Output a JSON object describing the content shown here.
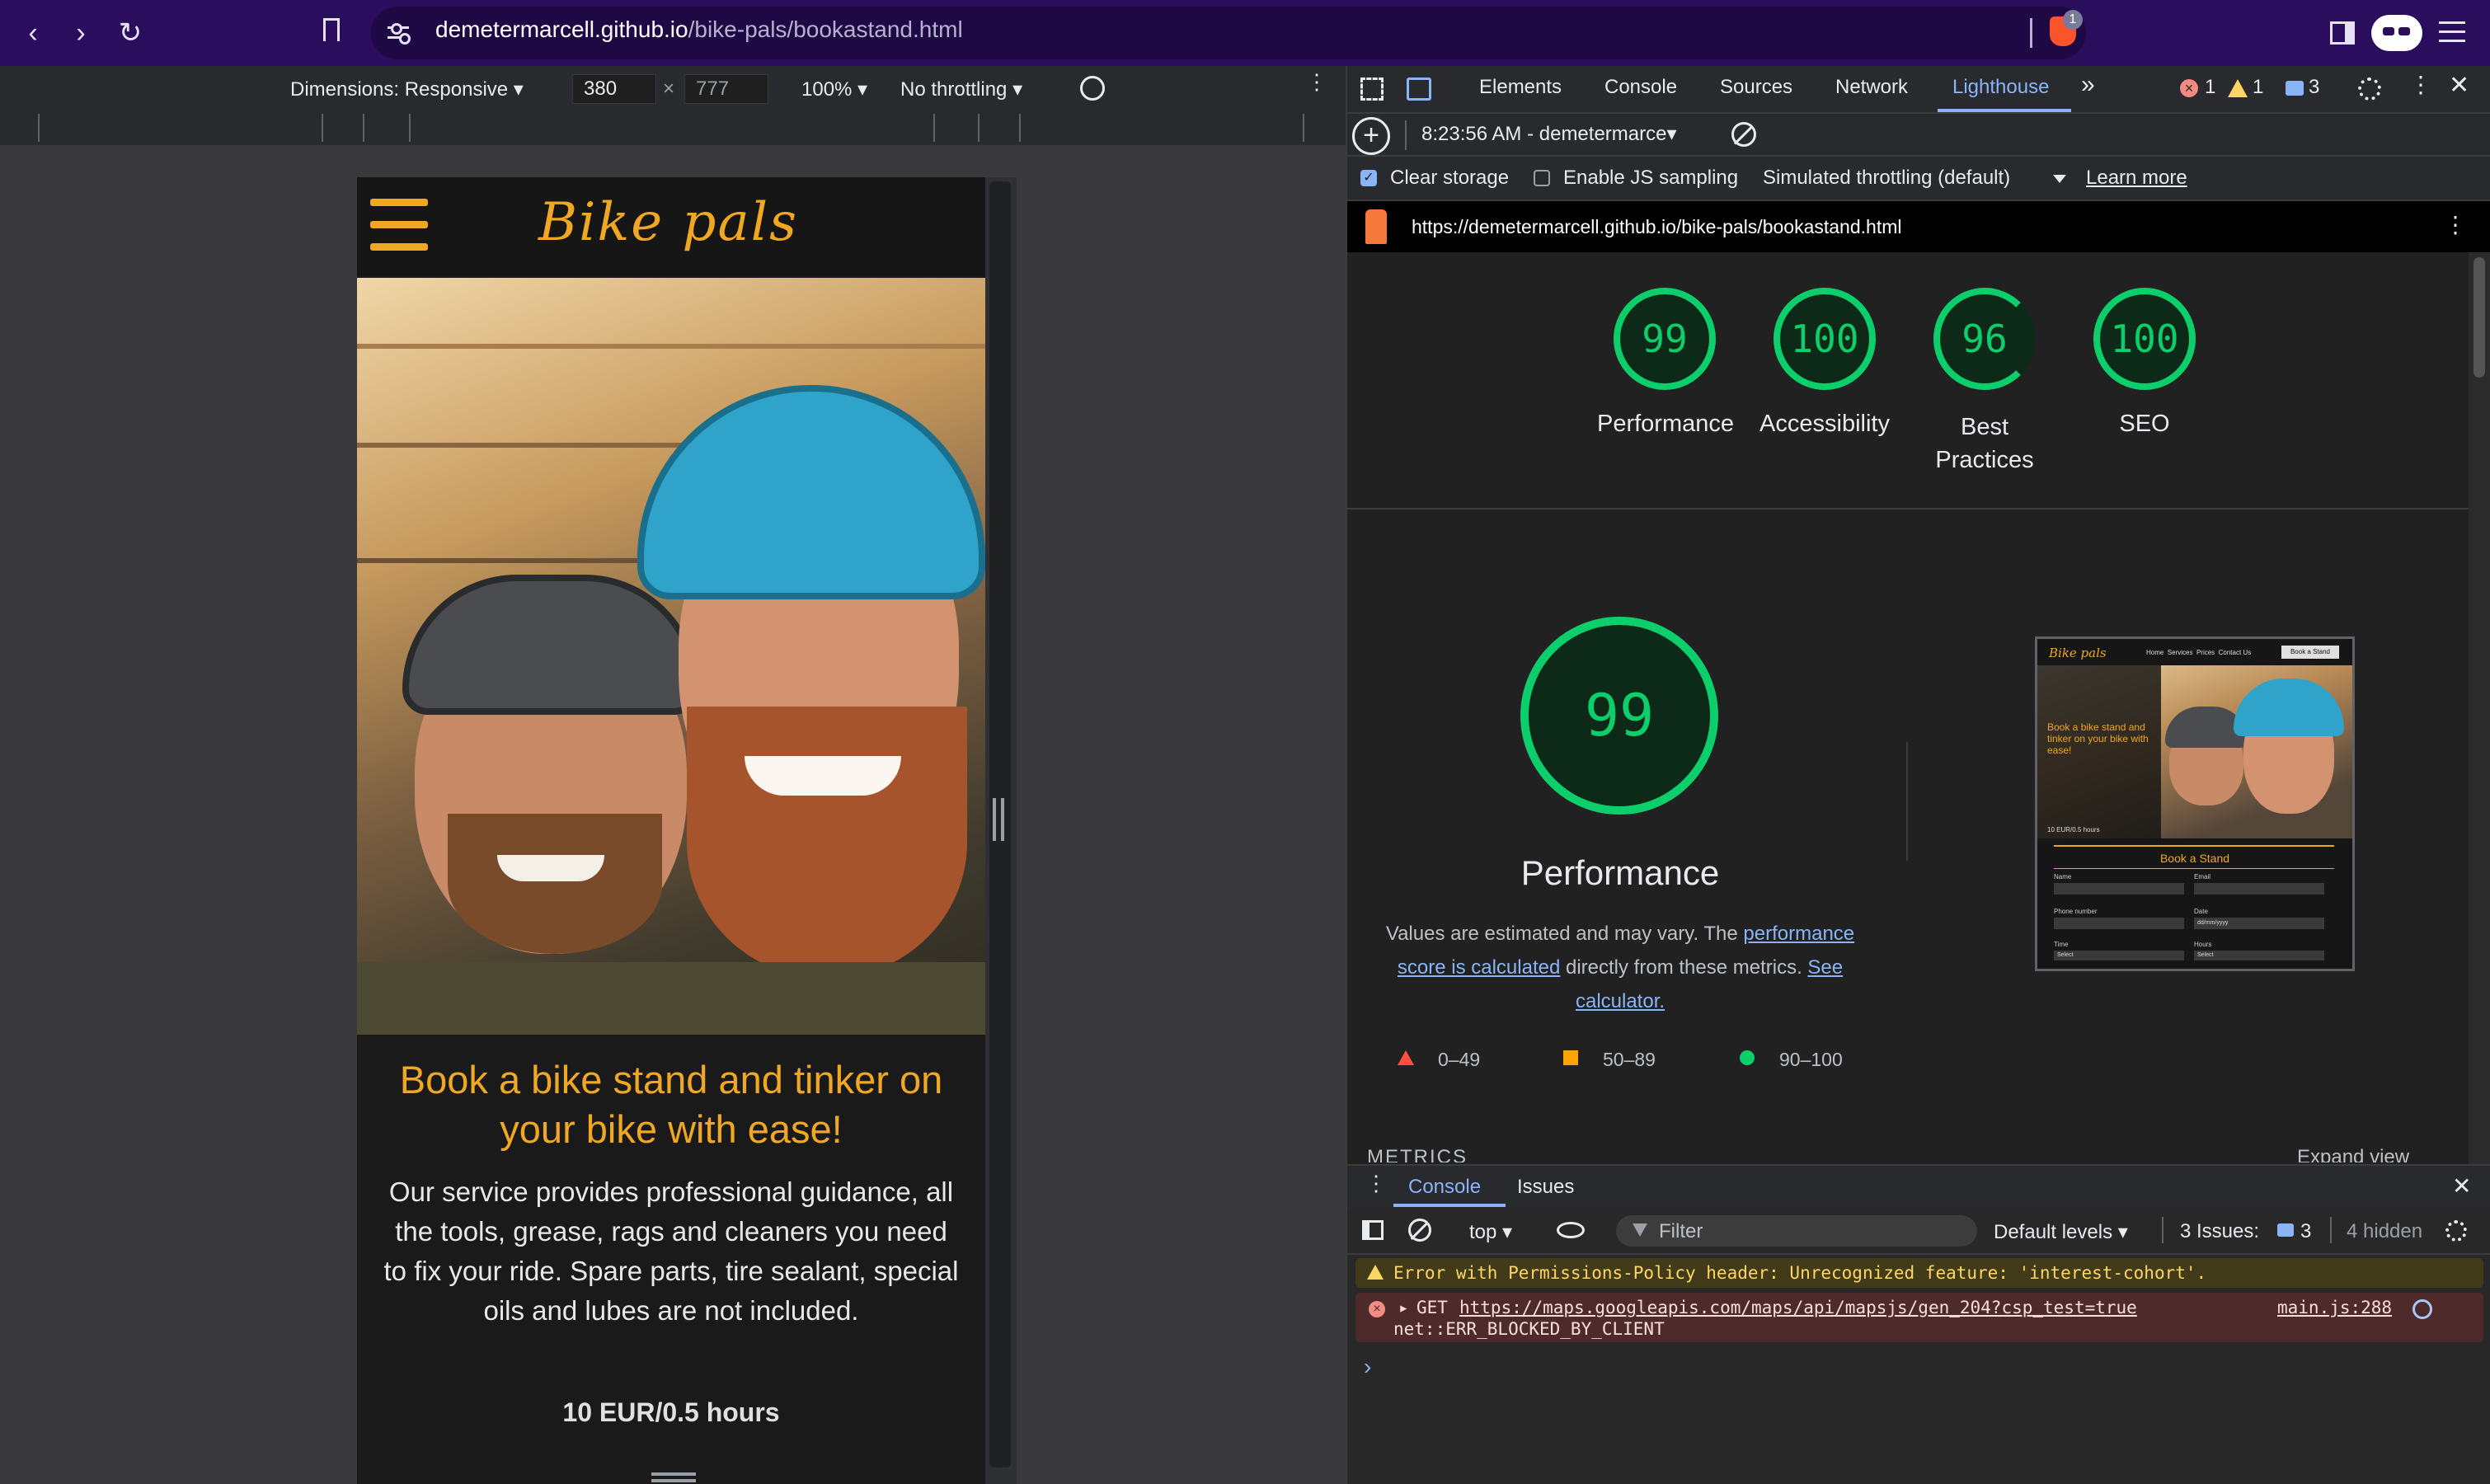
{
  "browser": {
    "url_host": "demetermarcell.github.io",
    "url_path": "/bike-pals/bookastand.html",
    "shields_badge": "1"
  },
  "device_toolbar": {
    "dimensions_label": "Dimensions: Responsive ▾",
    "width_value": "380",
    "times_symbol": "×",
    "height_value": "777",
    "zoom_label": "100% ▾",
    "throttling_label": "No throttling ▾"
  },
  "site": {
    "logo_text": "Bike pals",
    "hero_title": "Book a bike stand and tinker on your bike with ease!",
    "hero_body": "Our service provides professional guidance, all the tools, grease, rags and cleaners you need to fix your ride. Spare parts, tire sealant, special oils and lubes are not included.",
    "price": "10 EUR/0.5 hours"
  },
  "devtools": {
    "tabs": [
      "Elements",
      "Console",
      "Sources",
      "Network",
      "Lighthouse"
    ],
    "more_tabs": "»",
    "errors_count": "1",
    "warnings_count": "1",
    "issues_count": "3",
    "lighthouse": {
      "report_time": "8:23:56 AM - demetermarce▾",
      "clear_storage_label": "Clear storage",
      "clear_storage_checked": true,
      "js_sampling_label": "Enable JS sampling",
      "js_sampling_checked": false,
      "throttling_label": "Simulated throttling (default)",
      "learn_more": "Learn more",
      "report_url": "https://demetermarcell.github.io/bike-pals/bookastand.html",
      "scores": [
        {
          "value": "99",
          "label": "Performance"
        },
        {
          "value": "100",
          "label": "Accessibility"
        },
        {
          "value": "96",
          "label": "Best Practices"
        },
        {
          "value": "100",
          "label": "SEO"
        }
      ],
      "performance_score": "99",
      "performance_heading": "Performance",
      "desc_prefix": "Values are estimated and may vary. The ",
      "desc_link1": "performance score is calculated",
      "desc_mid": " directly from these metrics. ",
      "desc_link2": "See calculator.",
      "legend": [
        {
          "range": "0–49",
          "color": "#ff4e42"
        },
        {
          "range": "50–89",
          "color": "#ffa400"
        },
        {
          "range": "90–100",
          "color": "#0cce6b"
        }
      ],
      "metrics_label": "METRICS",
      "expand_view": "Expand view"
    },
    "thumbnail": {
      "logo": "Bike pals",
      "nav": [
        "Home",
        "Services",
        "Prices",
        "Contact Us"
      ],
      "cta": "Book a Stand",
      "hero": "Book a bike stand and tinker on your bike with ease!",
      "price": "10 EUR/0.5 hours",
      "form_title": "Book a Stand",
      "fields": [
        "Name",
        "Email",
        "Phone number",
        "Date",
        "Time",
        "Hours"
      ],
      "date_placeholder": "dd/mm/yyyy",
      "select_placeholder": "Select"
    },
    "console": {
      "tabs": [
        "Console",
        "Issues"
      ],
      "context": "top ▾",
      "filter_placeholder": "Filter",
      "levels": "Default levels ▾",
      "issues_label": "3 Issues:",
      "issues_count": "3",
      "hidden": "4 hidden",
      "warning": "Error with Permissions-Policy header: Unrecognized feature: 'interest-cohort'.",
      "error_method": "GET",
      "error_url": "https://maps.googleapis.com/maps/api/mapsjs/gen_204?csp_test=true",
      "error_source": "main.js:288",
      "error_detail": "net::ERR_BLOCKED_BY_CLIENT",
      "prompt": "›"
    }
  },
  "colors": {
    "brand_orange": "#f0a823",
    "score_green": "#0cce6b",
    "browser_purple": "#2b0d5e",
    "link_blue": "#8ab4f8"
  }
}
